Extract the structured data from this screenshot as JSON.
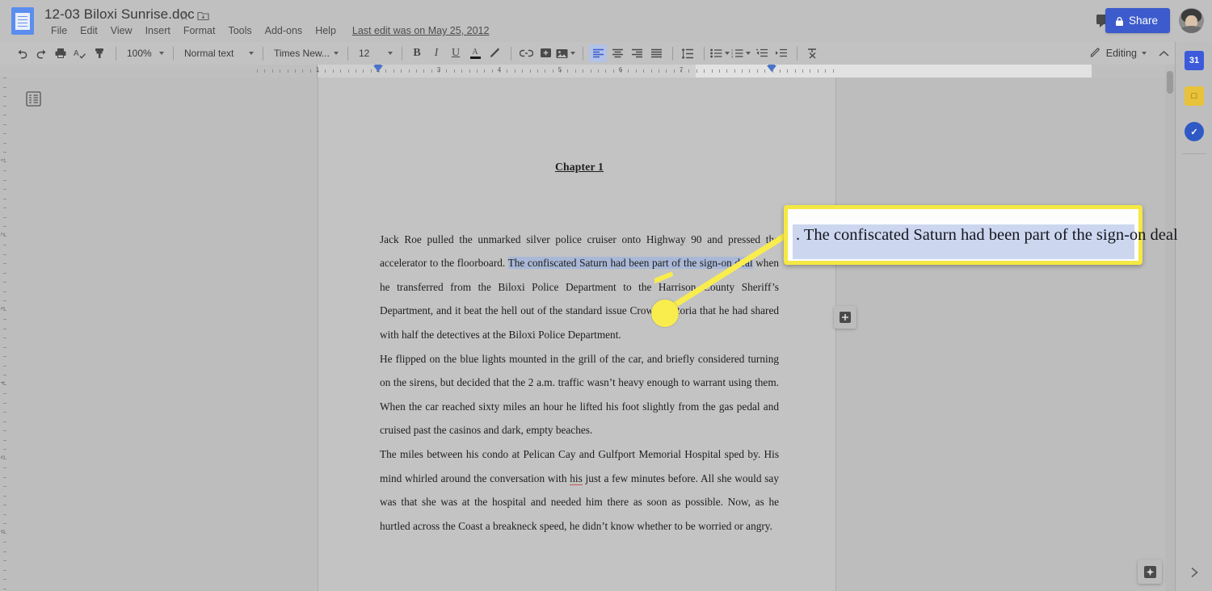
{
  "app": {
    "product_icon": "google-docs-icon",
    "doc_title": "12-03 Biloxi Sunrise.doc",
    "star_glyph": "☆",
    "last_edit": "Last edit was on May 25, 2012"
  },
  "menubar": {
    "items": [
      {
        "label": "File"
      },
      {
        "label": "Edit"
      },
      {
        "label": "View"
      },
      {
        "label": "Insert"
      },
      {
        "label": "Format"
      },
      {
        "label": "Tools"
      },
      {
        "label": "Add-ons"
      },
      {
        "label": "Help"
      }
    ]
  },
  "header_actions": {
    "comment_history_icon": "comment-icon",
    "share_label": "Share",
    "share_color": "#3c5bcc",
    "avatar_name": "user-avatar"
  },
  "toolbar": {
    "undo": "undo-icon",
    "redo": "redo-icon",
    "print": "print-icon",
    "spelling": "spellcheck-icon",
    "paint_format": "paint-format-icon",
    "zoom_value": "100%",
    "style_value": "Normal text",
    "font_value": "Times New...",
    "size_value": "12",
    "bold": "B",
    "italic": "I",
    "underline": "U",
    "text_color": "A",
    "highlight": "highlight-pen-icon",
    "link": "link-icon",
    "add_comment": "add-comment-icon",
    "insert_image": "image-icon",
    "align_left": "align-left-icon",
    "align_center": "align-center-icon",
    "align_right": "align-right-icon",
    "align_justify": "align-justify-icon",
    "line_spacing": "line-spacing-icon",
    "bulleted_list": "bulleted-list-icon",
    "numbered_list": "numbered-list-icon",
    "decrease_indent": "decrease-indent-icon",
    "increase_indent": "increase-indent-icon",
    "clear_formatting": "clear-formatting-icon",
    "mode_label": "Editing",
    "mode_icon": "pencil-icon",
    "collapse_icon": "chevron-up-icon",
    "active_align": "align-left"
  },
  "ruler": {
    "numbers": [
      "1",
      "2",
      "3",
      "4",
      "5",
      "6",
      "7"
    ],
    "vertical_numbers": [
      "1",
      "2",
      "3",
      "4",
      "5",
      "6"
    ],
    "left_indent_marker": "indent-marker-left",
    "right_indent_marker": "indent-marker-right"
  },
  "document": {
    "outline_toggle_icon": "document-outline-icon",
    "heading": "Chapter 1",
    "paragraphs": [
      {
        "id": "p1",
        "pre": "Jack Roe pulled the unmarked silver police cruiser onto Highway 90 and pressed the accelerator to the floorboard. ",
        "selected": "The confiscated Saturn had been part of the sign-on deal",
        "post": " when he transferred from the Biloxi Police Department to the Harrison County Sheriff’s Department, and it beat the hell out of the standard issue Crown Victoria that he had shared with half the detectives at the Biloxi Police Department."
      },
      {
        "id": "p2",
        "text": "He flipped on the blue lights mounted in the grill of the car, and briefly considered turning on the sirens, but decided that the 2 a.m. traffic wasn’t heavy enough to warrant using them. When the car reached sixty miles an hour he lifted his foot slightly from the gas pedal and cruised past the casinos and dark, empty beaches."
      },
      {
        "id": "p3",
        "pre": "The miles between his condo at Pelican Cay and Gulfport Memorial Hospital sped by. His mind whirled around the conversation with ",
        "misspelled": "his",
        "post": " just a few minutes before. All she would say was that she was at the hospital and needed him there as soon as possible. Now, as he hurtled across the Coast a breakneck speed, he didn’t know whether to be worried or angry."
      }
    ],
    "add_comment_margin_icon": "add-comment-margin-icon",
    "selection_color": "#a9b8d6"
  },
  "callout": {
    "lead": ".",
    "text": "The confiscated Saturn had been part of the sign-on deal",
    "border_color": "#f5e842",
    "highlight_color": "#ccd7ef",
    "pointer_color": "#f9ed4e"
  },
  "sidepanel": {
    "items": [
      {
        "name": "google-calendar-icon",
        "glyph": "31",
        "color": "#3b5bdb"
      },
      {
        "name": "google-keep-icon",
        "glyph": "□",
        "color": "#e8c33a"
      },
      {
        "name": "google-tasks-icon",
        "glyph": "✓",
        "color": "#2f5ac6"
      }
    ],
    "expand_icon": "chevron-right-icon"
  },
  "footer": {
    "explore_icon": "explore-icon"
  }
}
